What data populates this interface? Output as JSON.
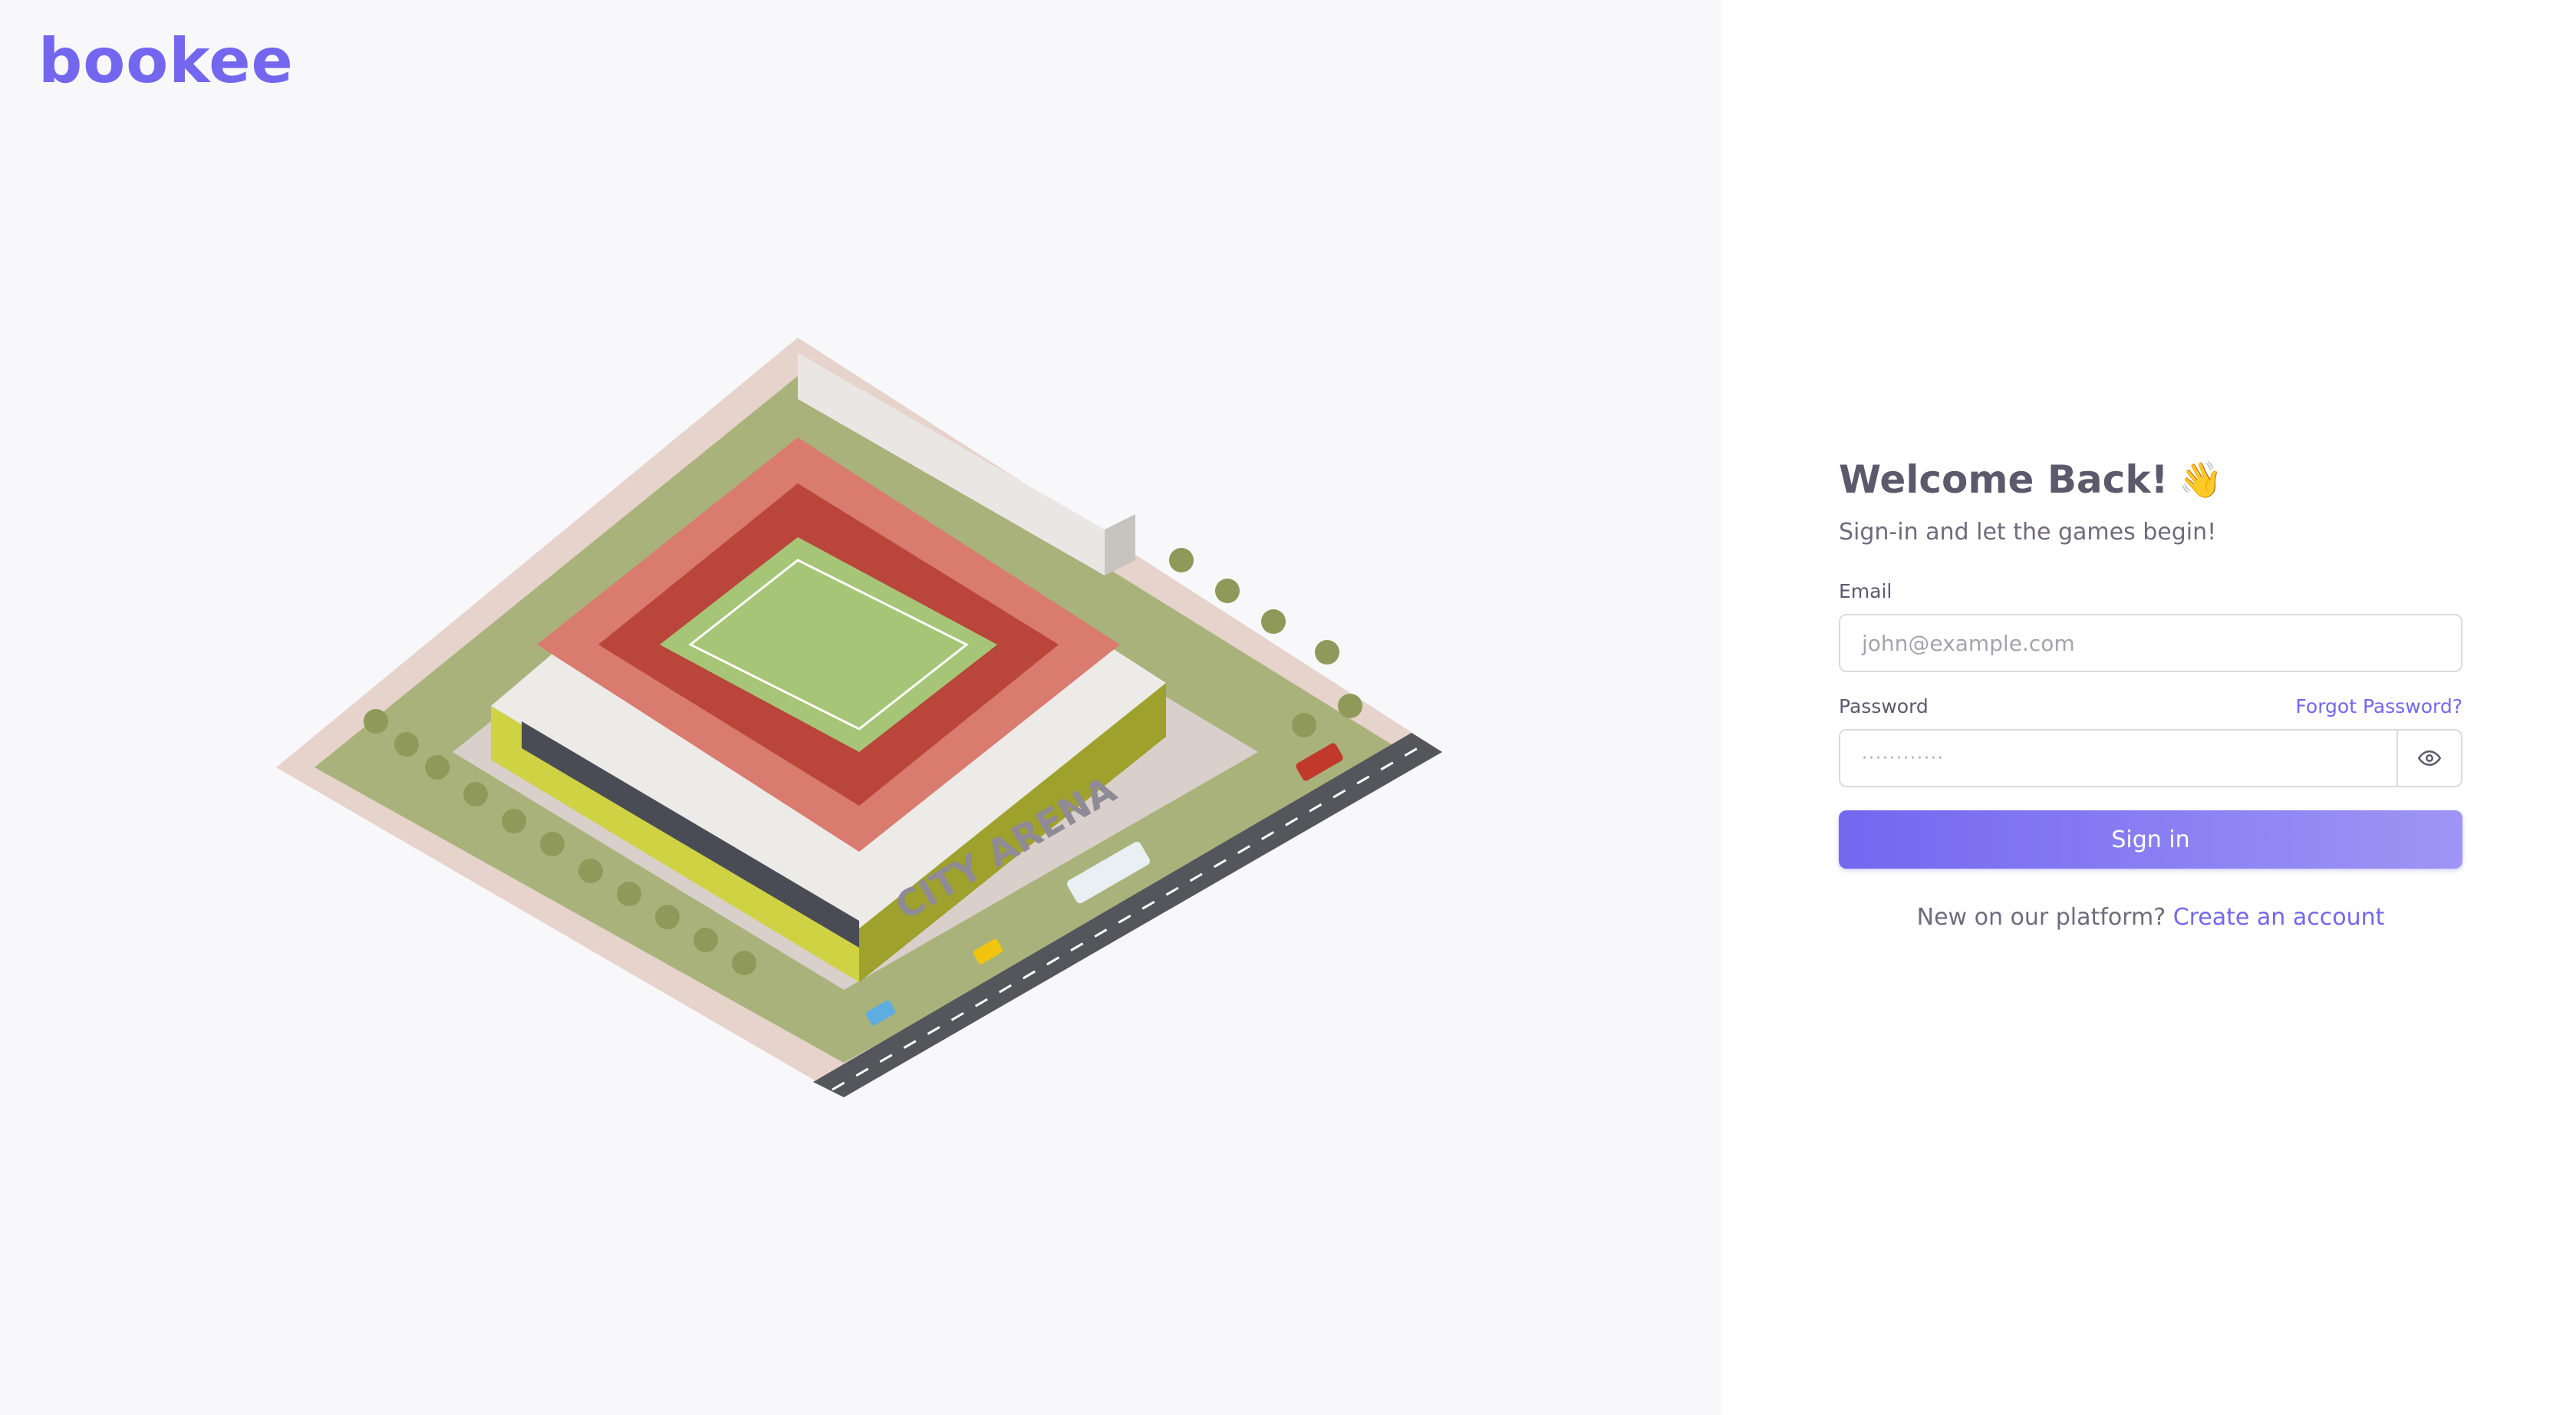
{
  "brand": {
    "name": "bookee"
  },
  "illustration": {
    "arena_sign": "CITY ARENA"
  },
  "login": {
    "title": "Welcome Back!",
    "title_emoji": "👋",
    "subtitle": "Sign-in and let the games begin!",
    "email_label": "Email",
    "email_placeholder": "john@example.com",
    "password_label": "Password",
    "forgot_link": "Forgot Password?",
    "password_placeholder": "············",
    "signin_button": "Sign in",
    "signup_prompt": "New on our platform?",
    "signup_link": "Create an account"
  },
  "colors": {
    "accent": "#7367f0",
    "accent_light": "#9e95f5",
    "left_bg": "#f8f7fa",
    "text": "#5d596c"
  },
  "icons": {
    "password_toggle": "eye-icon"
  }
}
